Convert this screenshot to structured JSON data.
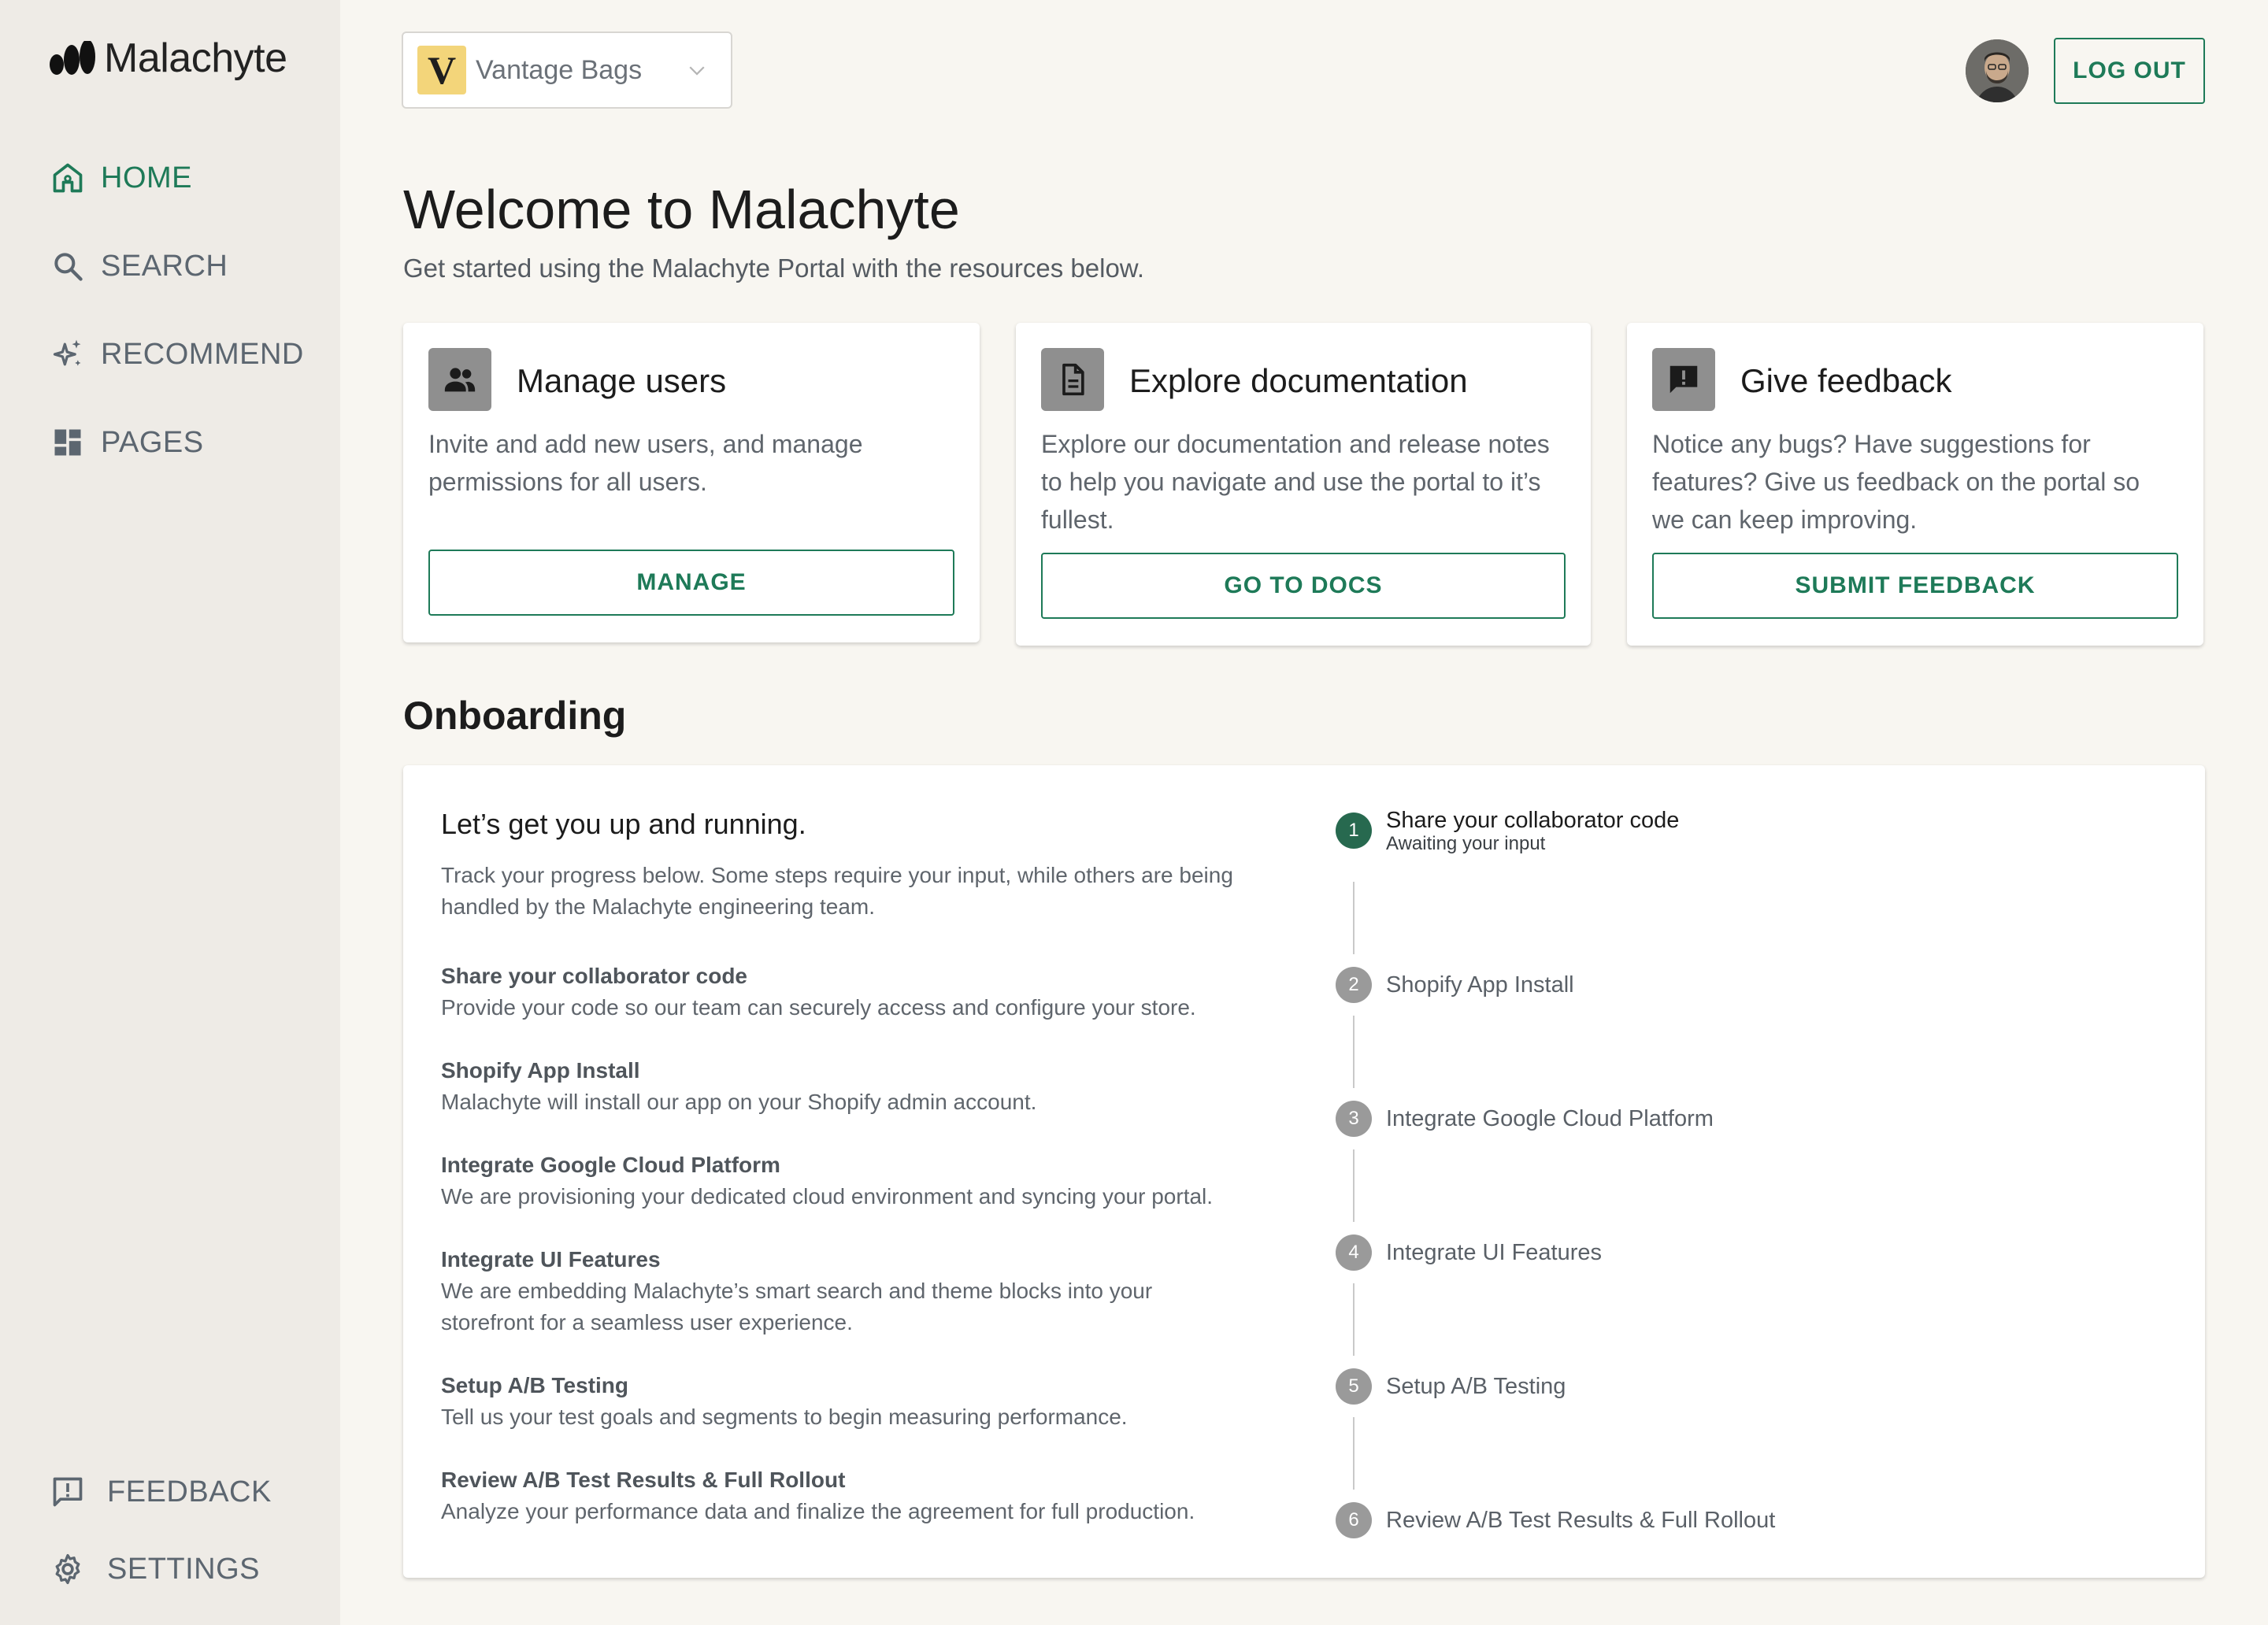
{
  "app": {
    "name": "Malachyte",
    "accent_color": "#1e7a58"
  },
  "sidebar": {
    "items": [
      {
        "label": "HOME",
        "icon": "home-icon",
        "active": true
      },
      {
        "label": "SEARCH",
        "icon": "search-icon",
        "active": false
      },
      {
        "label": "RECOMMEND",
        "icon": "sparkle-icon",
        "active": false
      },
      {
        "label": "PAGES",
        "icon": "dashboard-icon",
        "active": false
      }
    ],
    "bottom_items": [
      {
        "label": "FEEDBACK",
        "icon": "feedback-icon"
      },
      {
        "label": "SETTINGS",
        "icon": "gear-icon"
      }
    ]
  },
  "topbar": {
    "brand_select": {
      "logo_letter": "V",
      "label": "Vantage Bags"
    },
    "logout_label": "LOG OUT"
  },
  "header": {
    "title": "Welcome to Malachyte",
    "subtitle": "Get started using the Malachyte Portal with the resources below."
  },
  "cards": [
    {
      "title": "Manage users",
      "icon": "users-icon",
      "description": "Invite and add new users, and manage permissions for all users.",
      "button": "MANAGE"
    },
    {
      "title": "Explore documentation",
      "icon": "document-icon",
      "description": "Explore our documentation and release notes to help you navigate and use the portal to it’s fullest.",
      "button": "GO TO DOCS"
    },
    {
      "title": "Give feedback",
      "icon": "feedback-alert-icon",
      "description": "Notice any bugs? Have suggestions for features? Give us feedback on the portal so we can keep improving.",
      "button": "SUBMIT FEEDBACK"
    }
  ],
  "onboarding": {
    "section_title": "Onboarding",
    "heading": "Let’s get you up and running.",
    "intro": "Track your progress below. Some steps require your input, while others are being handled by the Malachyte engineering team.",
    "steps": [
      {
        "title": "Share your collaborator code",
        "description": "Provide your code so our team can securely access and configure your store."
      },
      {
        "title": "Shopify App Install",
        "description": "Malachyte will install our app on your Shopify admin account."
      },
      {
        "title": "Integrate Google Cloud Platform",
        "description": "We are provisioning your dedicated cloud environment and syncing your portal."
      },
      {
        "title": "Integrate UI Features",
        "description": "We are embedding Malachyte’s smart search and theme blocks into your storefront for a seamless user experience."
      },
      {
        "title": "Setup A/B Testing",
        "description": "Tell us your test goals and segments to begin measuring performance."
      },
      {
        "title": "Review A/B Test Results & Full Rollout",
        "description": "Analyze your performance data and finalize the agreement for full production."
      }
    ],
    "stepper": [
      {
        "number": "1",
        "label": "Share your collaborator code",
        "status": "Awaiting your input",
        "active": true
      },
      {
        "number": "2",
        "label": "Shopify App Install",
        "active": false
      },
      {
        "number": "3",
        "label": "Integrate Google Cloud Platform",
        "active": false
      },
      {
        "number": "4",
        "label": "Integrate UI Features",
        "active": false
      },
      {
        "number": "5",
        "label": "Setup A/B Testing",
        "active": false
      },
      {
        "number": "6",
        "label": "Review A/B Test Results & Full Rollout",
        "active": false
      }
    ]
  }
}
